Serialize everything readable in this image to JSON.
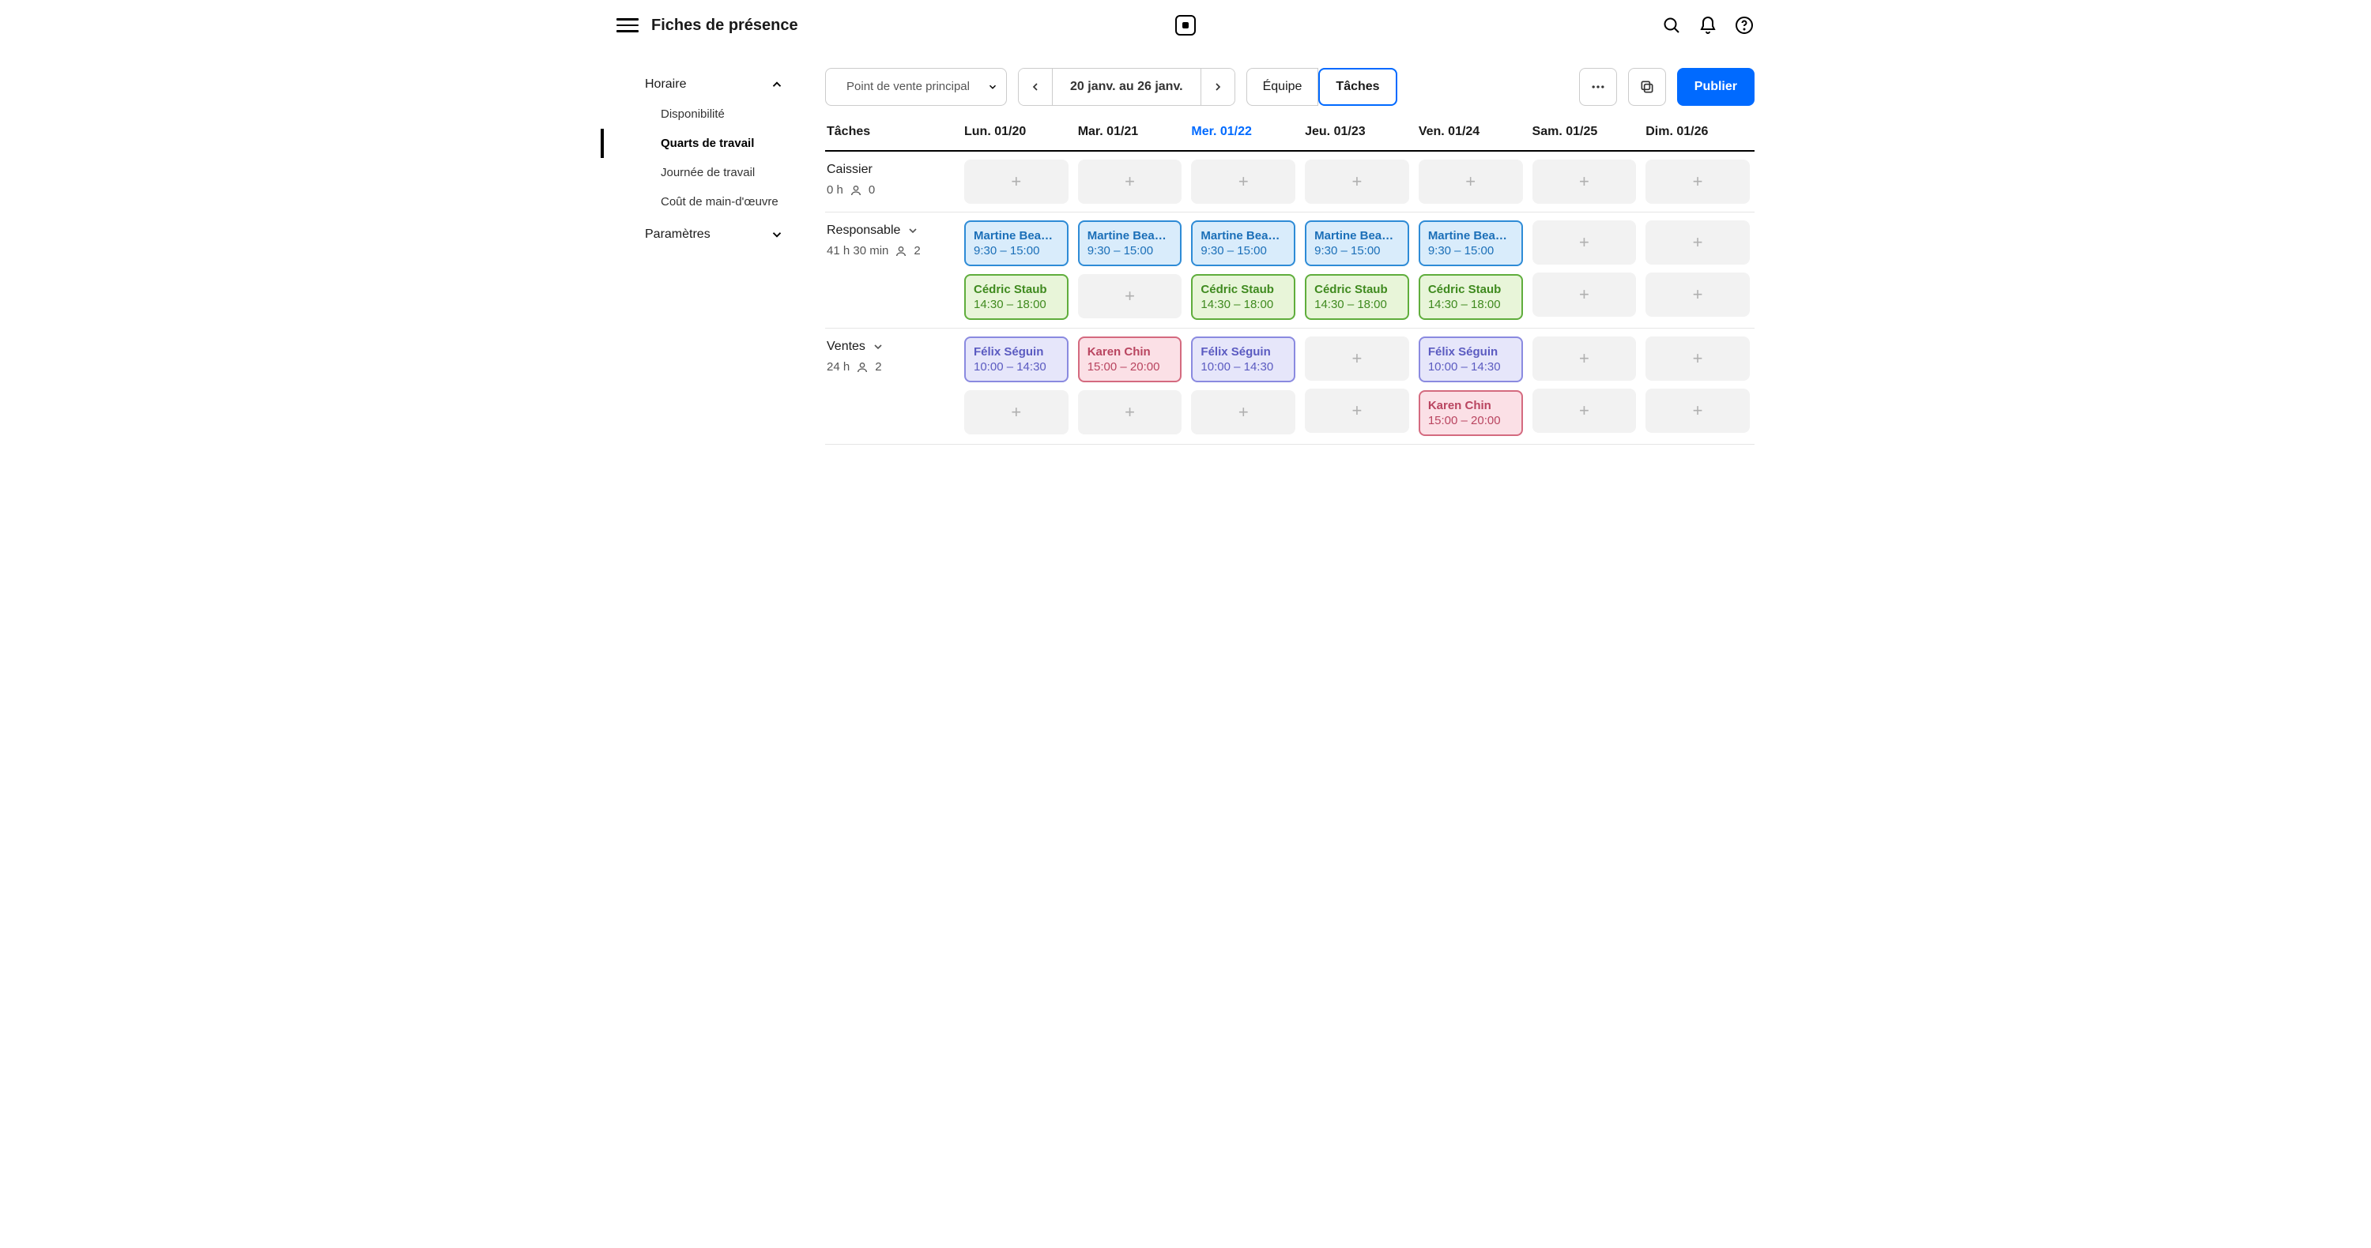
{
  "header": {
    "title": "Fiches de présence"
  },
  "sidebar": {
    "horaire": {
      "label": "Horaire",
      "items": [
        {
          "label": "Disponibilité"
        },
        {
          "label": "Quarts de travail"
        },
        {
          "label": "Journée de travail"
        },
        {
          "label": "Coût de main-d'œuvre"
        }
      ]
    },
    "parametres": {
      "label": "Paramètres"
    }
  },
  "toolbar": {
    "location": "Point de vente principal",
    "range": "20 janv. au 26 janv.",
    "view_team": "Équipe",
    "view_jobs": "Tâches",
    "publish": "Publier"
  },
  "columns": {
    "jobs": "Tâches",
    "d0": "Lun. 01/20",
    "d1": "Mar. 01/21",
    "d2": "Mer. 01/22",
    "d3": "Jeu. 01/23",
    "d4": "Ven. 01/24",
    "d5": "Sam. 01/25",
    "d6": "Dim. 01/26"
  },
  "jobs": {
    "cashier": {
      "name": "Caissier",
      "hours": "0 h",
      "people": "0"
    },
    "manager": {
      "name": "Responsable",
      "hours": "41 h 30 min",
      "people": "2"
    },
    "sales": {
      "name": "Ventes",
      "hours": "24 h",
      "people": "2"
    }
  },
  "shifts": {
    "martine": {
      "name": "Martine Bea…",
      "time": "9:30 – 15:00"
    },
    "cedric": {
      "name": "Cédric Staub",
      "time": "14:30 – 18:00"
    },
    "felix": {
      "name": "Félix Séguin",
      "time": "10:00 – 14:30"
    },
    "karen": {
      "name": "Karen Chin",
      "time": "15:00 – 20:00"
    }
  }
}
